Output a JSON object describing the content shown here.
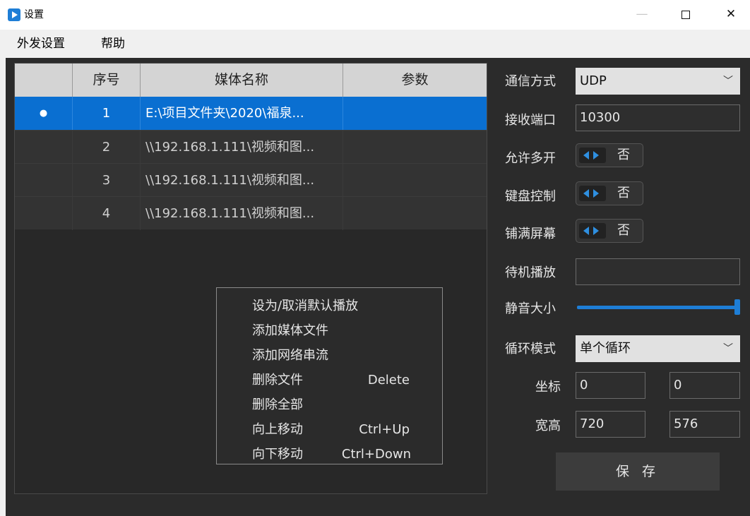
{
  "window": {
    "title": "设置"
  },
  "menu": {
    "items": [
      "外发设置",
      "帮助"
    ]
  },
  "table": {
    "columns": [
      "",
      "序号",
      "媒体名称",
      "参数"
    ],
    "rows": [
      {
        "marker": "●",
        "index": "1",
        "name": "E:\\项目文件夹\\2020\\福泉...",
        "params": ""
      },
      {
        "marker": "",
        "index": "2",
        "name": "\\\\192.168.1.111\\视频和图...",
        "params": ""
      },
      {
        "marker": "",
        "index": "3",
        "name": "\\\\192.168.1.111\\视频和图...",
        "params": ""
      },
      {
        "marker": "",
        "index": "4",
        "name": "\\\\192.168.1.111\\视频和图...",
        "params": ""
      }
    ]
  },
  "context_menu": {
    "items": [
      {
        "label": "设为/取消默认播放",
        "shortcut": ""
      },
      {
        "label": "添加媒体文件",
        "shortcut": ""
      },
      {
        "label": "添加网络串流",
        "shortcut": ""
      },
      {
        "label": "删除文件",
        "shortcut": "Delete"
      },
      {
        "label": "删除全部",
        "shortcut": ""
      },
      {
        "label": "向上移动",
        "shortcut": "Ctrl+Up"
      },
      {
        "label": "向下移动",
        "shortcut": "Ctrl+Down"
      }
    ]
  },
  "settings": {
    "comm_label": "通信方式",
    "comm_value": "UDP",
    "port_label": "接收端口",
    "port_value": "10300",
    "multi_label": "允许多开",
    "multi_value": "否",
    "keyboard_label": "键盘控制",
    "keyboard_value": "否",
    "fill_label": "铺满屏幕",
    "fill_value": "否",
    "standby_label": "待机播放",
    "standby_value": "",
    "volume_label": "静音大小",
    "volume_level": 1.0,
    "loop_label": "循环模式",
    "loop_value": "单个循环",
    "coord_label": "坐标",
    "coord_x": "0",
    "coord_y": "0",
    "size_label": "宽高",
    "width": "720",
    "height": "576",
    "save_label": "保 存"
  },
  "colors": {
    "accent": "#1e7ed6",
    "selected_row": "#0a6fd1",
    "background": "#2b2b2b"
  }
}
